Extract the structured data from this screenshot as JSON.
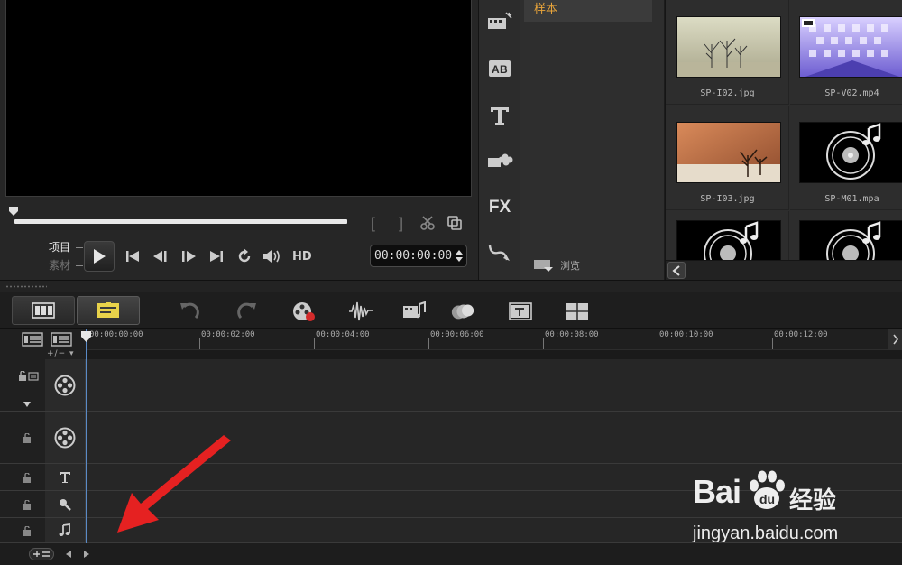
{
  "preview": {
    "mode_project": "项目",
    "mode_clip": "素材",
    "hd": "HD",
    "timecode": "00:00:00:00",
    "trim_in": "[",
    "trim_out": "]"
  },
  "library": {
    "folder_sample": "样本",
    "browse": "浏览",
    "items": [
      {
        "caption": "SP-I02.jpg"
      },
      {
        "caption": "SP-V02.mp4"
      },
      {
        "caption": "SP-I03.jpg"
      },
      {
        "caption": "SP-M01.mpa"
      },
      {
        "caption": ""
      },
      {
        "caption": ""
      }
    ]
  },
  "library_tools": {
    "fx": "FX"
  },
  "timeline": {
    "zoom_label": "+/− ▾",
    "ruler": [
      "00:00:00:00",
      "00:00:02:00",
      "00:00:04:00",
      "00:00:06:00",
      "00:00:08:00",
      "00:00:10:00",
      "00:00:12:00"
    ]
  },
  "watermark": {
    "logo_text": "Bai",
    "logo_cn": "经验",
    "url": "jingyan.baidu.com"
  },
  "colors": {
    "accent": "#e8a43b",
    "timeline_active": "#e8d24a",
    "annotation_arrow": "#e52121",
    "playhead": "#5a8ac6"
  }
}
